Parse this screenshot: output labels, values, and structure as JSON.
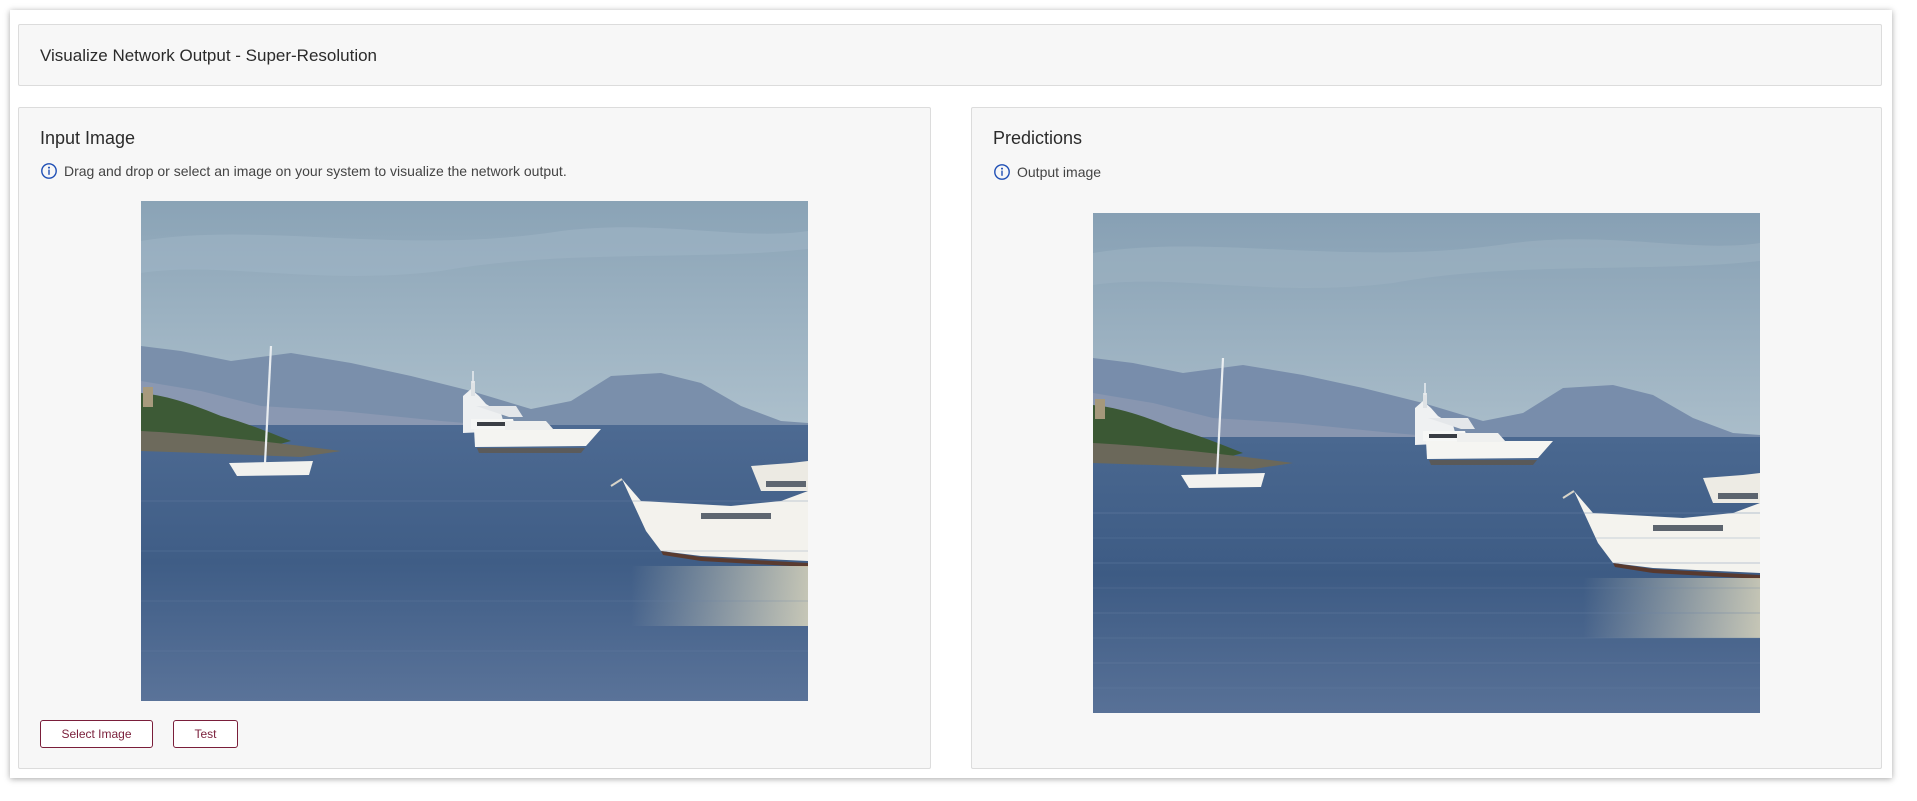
{
  "header": {
    "title": "Visualize Network Output - Super-Resolution"
  },
  "input_panel": {
    "title": "Input Image",
    "info_text": "Drag and drop or select an image on your system to visualize the network output.",
    "select_button": "Select Image",
    "test_button": "Test",
    "image_alt": "Harbor with yachts and a sailboat in front of mountains"
  },
  "predictions_panel": {
    "title": "Predictions",
    "info_text": "Output image",
    "image_alt": "Super-resolved harbor with yachts and a sailboat in front of mountains"
  },
  "colors": {
    "accent": "#7a1e3a",
    "info_icon": "#1f4fb5",
    "panel_bg": "#f7f7f7",
    "border": "#dcdcdc"
  },
  "icons": {
    "info": "info-circle-icon"
  }
}
